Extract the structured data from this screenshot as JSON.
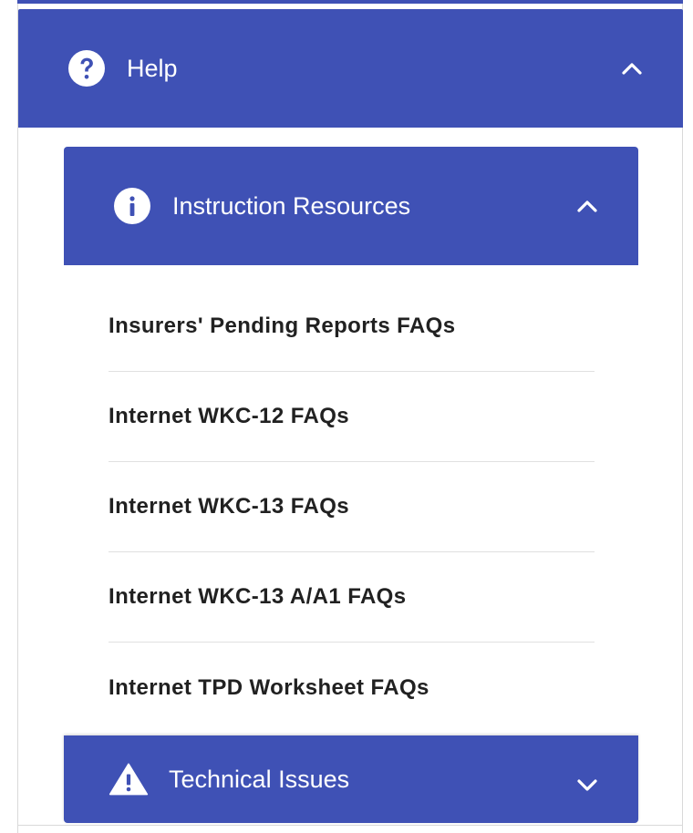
{
  "colors": {
    "accent": "#3f51b5",
    "header_text": "#ffffff",
    "item_text": "#212121",
    "divider": "#e0e0e0"
  },
  "help": {
    "title": "Help",
    "icon": "question-circle-icon",
    "toggle_icon": "chevron-up-icon"
  },
  "instruction_resources": {
    "title": "Instruction Resources",
    "icon": "info-circle-icon",
    "toggle_icon": "chevron-up-icon",
    "items": [
      {
        "label": "Insurers' Pending Reports FAQs"
      },
      {
        "label": "Internet WKC-12 FAQs"
      },
      {
        "label": "Internet WKC-13 FAQs"
      },
      {
        "label": "Internet WKC-13 A/A1 FAQs"
      },
      {
        "label": "Internet TPD Worksheet FAQs"
      }
    ]
  },
  "technical_issues": {
    "title": "Technical Issues",
    "icon": "warning-triangle-icon",
    "toggle_icon": "chevron-down-icon"
  }
}
